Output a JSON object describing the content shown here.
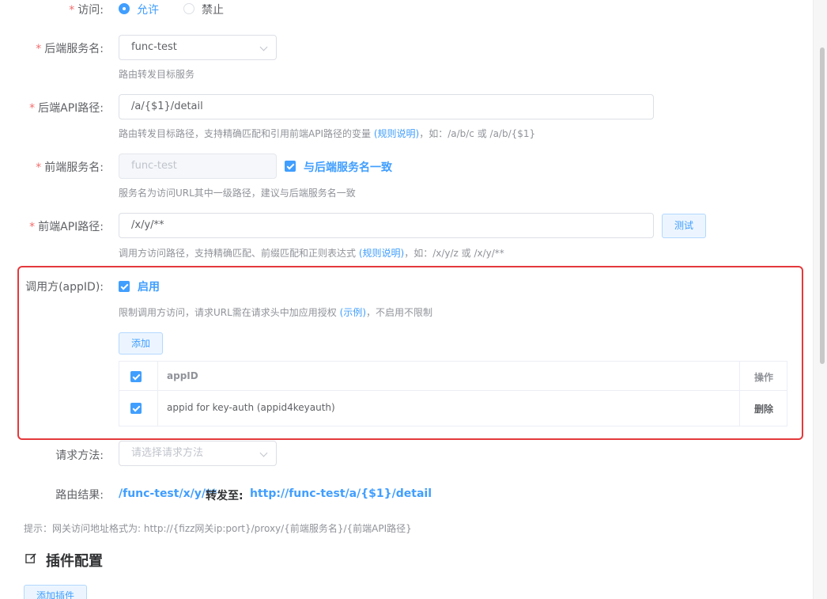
{
  "access": {
    "label": "访问:",
    "options": [
      "允许",
      "禁止"
    ],
    "selected": "允许"
  },
  "backend_service": {
    "label": "后端服务名:",
    "value": "func-test",
    "tip": "路由转发目标服务"
  },
  "backend_api": {
    "label": "后端API路径:",
    "value": "/a/{$1}/detail",
    "tip_prefix": "路由转发目标路径，支持精确匹配和引用前端API路径的变量",
    "tip_link": "(规则说明)",
    "tip_suffix": "，如：/a/b/c 或 /a/b/{$1}"
  },
  "frontend_service": {
    "label": "前端服务名:",
    "value": "func-test",
    "checkbox_label": "与后端服务名一致",
    "tip": "服务名为访问URL其中一级路径，建议与后端服务名一致"
  },
  "frontend_api": {
    "label": "前端API路径:",
    "value": "/x/y/**",
    "test_button": "测试",
    "tip_prefix": "调用方访问路径，支持精确匹配、前缀匹配和正则表达式",
    "tip_link": "(规则说明)",
    "tip_suffix": "，如：/x/y/z 或 /x/y/**"
  },
  "caller": {
    "label": "调用方(appID):",
    "enable_label": "启用",
    "tip_prefix": "限制调用方访问，请求URL需在请求头中加应用授权",
    "tip_link": "(示例)",
    "tip_suffix": "，不启用不限制",
    "add_button": "添加",
    "table": {
      "col_appid": "appID",
      "col_action": "操作",
      "rows": [
        {
          "appid": "appid for key-auth (appid4keyauth)",
          "action": "删除"
        }
      ]
    }
  },
  "method": {
    "label": "请求方法:",
    "placeholder": "请选择请求方法"
  },
  "result": {
    "label": "路由结果:",
    "from": "/func-test/x/y/**",
    "arrow": "转发至:",
    "to": "http://func-test/a/{$1}/detail"
  },
  "note": "提示：网关访问地址格式为: http://{fizz网关ip:port}/proxy/{前端服务名}/{前端API路径}",
  "plugins": {
    "title": "插件配置",
    "add_button": "添加插件"
  }
}
